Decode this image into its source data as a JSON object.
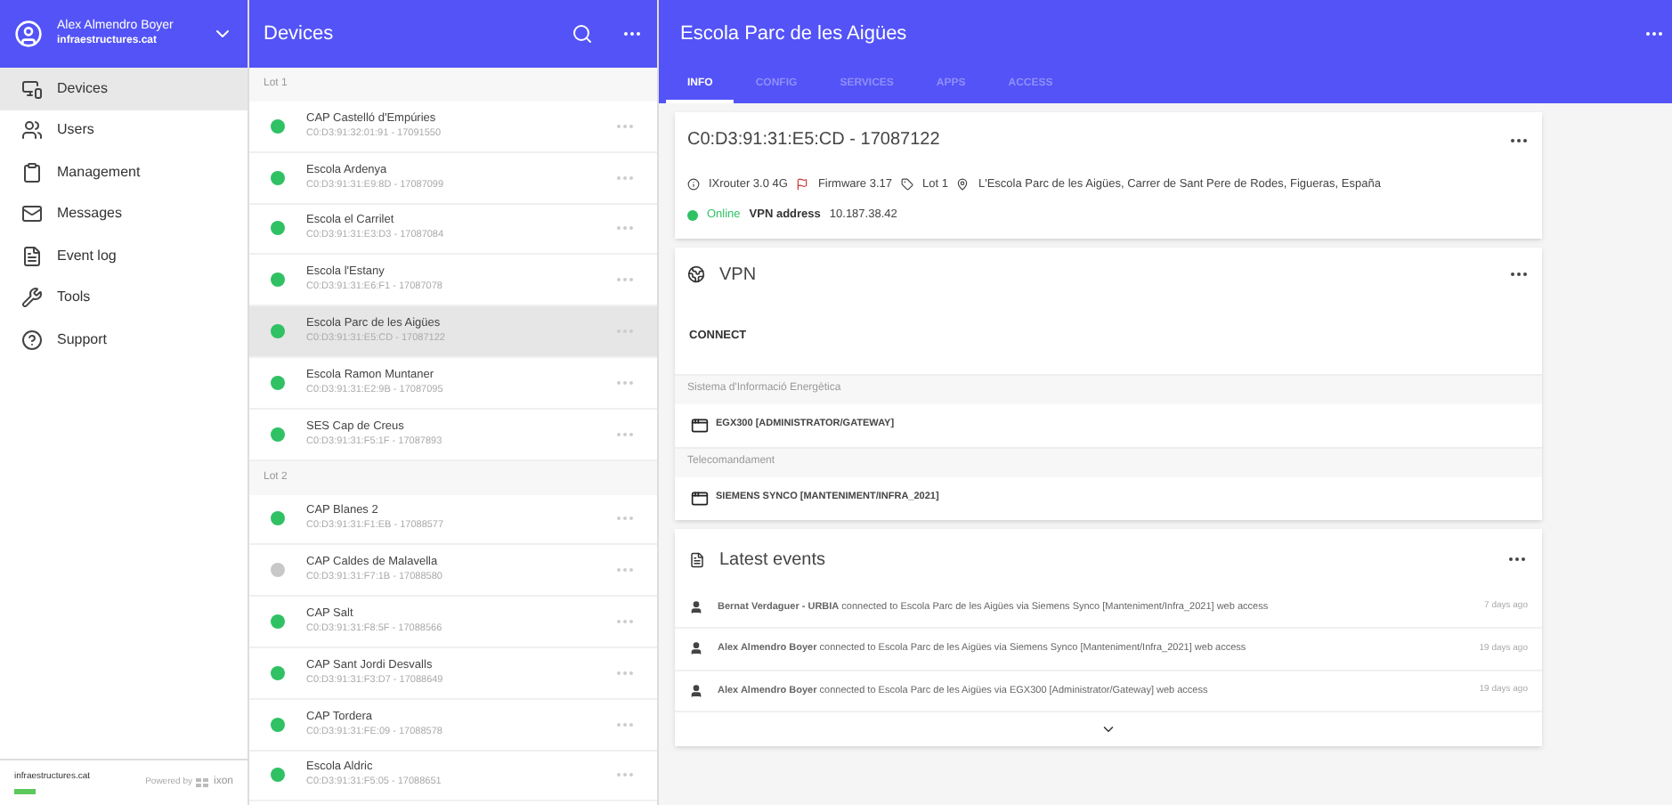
{
  "sidebar": {
    "user": {
      "name": "Alex Almendro Boyer",
      "email": "infraestructures.cat"
    },
    "items": [
      {
        "label": "Devices",
        "selected": true
      },
      {
        "label": "Users",
        "selected": false
      },
      {
        "label": "Management",
        "selected": false
      },
      {
        "label": "Messages",
        "selected": false
      },
      {
        "label": "Event log",
        "selected": false
      },
      {
        "label": "Tools",
        "selected": false
      },
      {
        "label": "Support",
        "selected": false
      }
    ],
    "footer": {
      "brand": "infraestructures.cat",
      "powered": "Powered by",
      "logo": "ixon"
    }
  },
  "device_list": {
    "title": "Devices",
    "groups": [
      {
        "label": "Lot 1",
        "devices": [
          {
            "name": "CAP Castelló d'Empúries",
            "id": "C0:D3:91:32:01:91 - 17091550",
            "online": true,
            "selected": false
          },
          {
            "name": "Escola Ardenya",
            "id": "C0:D3:91:31:E9:8D - 17087099",
            "online": true,
            "selected": false
          },
          {
            "name": "Escola el Carrilet",
            "id": "C0:D3:91:31:E3:D3 - 17087084",
            "online": true,
            "selected": false
          },
          {
            "name": "Escola l'Estany",
            "id": "C0:D3:91:31:E6:F1 - 17087078",
            "online": true,
            "selected": false
          },
          {
            "name": "Escola Parc de les Aigües",
            "id": "C0:D3:91:31:E5:CD - 17087122",
            "online": true,
            "selected": true
          },
          {
            "name": "Escola Ramon Muntaner",
            "id": "C0:D3:91:31:E2:9B - 17087095",
            "online": true,
            "selected": false
          },
          {
            "name": "SES Cap de Creus",
            "id": "C0:D3:91:31:F5:1F - 17087893",
            "online": true,
            "selected": false
          }
        ]
      },
      {
        "label": "Lot 2",
        "devices": [
          {
            "name": "CAP Blanes 2",
            "id": "C0:D3:91:31:F1:EB - 17088577",
            "online": true,
            "selected": false
          },
          {
            "name": "CAP Caldes de Malavella",
            "id": "C0:D3:91:31:F7:1B - 17088580",
            "online": false,
            "selected": false
          },
          {
            "name": "CAP Salt",
            "id": "C0:D3:91:31:F8:5F - 17088566",
            "online": true,
            "selected": false
          },
          {
            "name": "CAP Sant Jordi Desvalls",
            "id": "C0:D3:91:31:F3:D7 - 17088649",
            "online": true,
            "selected": false
          },
          {
            "name": "CAP Tordera",
            "id": "C0:D3:91:31:FE:09 - 17088578",
            "online": true,
            "selected": false
          },
          {
            "name": "Escola Aldric",
            "id": "C0:D3:91:31:F5:05 - 17088651",
            "online": true,
            "selected": false
          }
        ]
      }
    ]
  },
  "detail": {
    "title": "Escola Parc de les Aigües",
    "tabs": [
      {
        "label": "INFO",
        "selected": true
      },
      {
        "label": "CONFIG",
        "selected": false
      },
      {
        "label": "SERVICES",
        "selected": false
      },
      {
        "label": "APPS",
        "selected": false
      },
      {
        "label": "ACCESS",
        "selected": false
      }
    ],
    "device_card": {
      "title": "C0:D3:91:31:E5:CD - 17087122",
      "model": "IXrouter 3.0 4G",
      "firmware": "Firmware 3.17",
      "lot": "Lot 1",
      "address": "L'Escola Parc de les Aigües, Carrer de Sant Pere de Rodes, Figueras, España",
      "status": "Online",
      "online": true,
      "vpn_label": "VPN address",
      "vpn_value": "10.187.38.42"
    },
    "vpn_card": {
      "title": "VPN",
      "connect": "CONNECT",
      "sections": [
        {
          "label": "Sistema d'Informació Energètica",
          "item": "EGX300 [ADMINISTRATOR/GATEWAY]"
        },
        {
          "label": "Telecomandament",
          "item": "SIEMENS SYNCO [MANTENIMENT/INFRA_2021]"
        }
      ]
    },
    "events_card": {
      "title": "Latest events",
      "events": [
        {
          "text": "**Bernat Verdaguer - URBIA** connected to Escola Parc de les Aigües via Siemens Synco [Manteniment/Infra_2021] web access",
          "time": "7 days ago"
        },
        {
          "text": "**Alex Almendro Boyer** connected to Escola Parc de les Aigües via Siemens Synco [Manteniment/Infra_2021] web access",
          "time": "19 days ago"
        },
        {
          "text": "**Alex Almendro Boyer** connected to Escola Parc de les Aigües via EGX300 [Administrator/Gateway] web access",
          "time": "19 days ago"
        }
      ]
    }
  }
}
